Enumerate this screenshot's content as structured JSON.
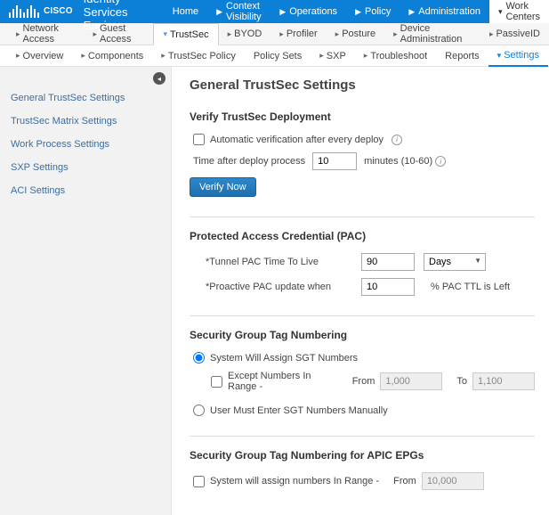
{
  "brand": {
    "logo_text": "CISCO",
    "app_title": "Identity Services Engine"
  },
  "topnav": {
    "home": "Home",
    "context": "Context Visibility",
    "operations": "Operations",
    "policy": "Policy",
    "administration": "Administration",
    "work_centers": "Work Centers"
  },
  "subnav": {
    "network_access": "Network Access",
    "guest_access": "Guest Access",
    "trustsec": "TrustSec",
    "byod": "BYOD",
    "profiler": "Profiler",
    "posture": "Posture",
    "device_admin": "Device Administration",
    "passiveid": "PassiveID"
  },
  "subnav2": {
    "overview": "Overview",
    "components": "Components",
    "trustsec_policy": "TrustSec Policy",
    "policy_sets": "Policy Sets",
    "sxp": "SXP",
    "troubleshoot": "Troubleshoot",
    "reports": "Reports",
    "settings": "Settings"
  },
  "sidebar": {
    "items": [
      "General TrustSec Settings",
      "TrustSec Matrix Settings",
      "Work Process Settings",
      "SXP Settings",
      "ACI Settings"
    ]
  },
  "page": {
    "title": "General TrustSec Settings",
    "verify": {
      "heading": "Verify TrustSec Deployment",
      "auto_label": "Automatic verification after every deploy",
      "time_label": "Time after deploy process",
      "time_value": "10",
      "minutes_label": "minutes (10-60)",
      "button": "Verify Now"
    },
    "pac": {
      "heading": "Protected Access Credential (PAC)",
      "ttl_label": "*Tunnel PAC Time To Live",
      "ttl_value": "90",
      "ttl_unit": "Days",
      "proactive_label": "*Proactive PAC update when",
      "proactive_value": "10",
      "proactive_after": "% PAC TTL is Left"
    },
    "sgt": {
      "heading": "Security Group Tag Numbering",
      "radio_system": "System Will Assign SGT Numbers",
      "except_label": "Except Numbers In Range -",
      "from_label": "From",
      "from_value": "1,000",
      "to_label": "To",
      "to_value": "1,100",
      "radio_manual": "User Must Enter SGT Numbers Manually"
    },
    "apic": {
      "heading": "Security Group Tag Numbering for APIC EPGs",
      "check_label": "System will assign numbers In Range -",
      "from_label": "From",
      "from_value": "10,000"
    }
  }
}
